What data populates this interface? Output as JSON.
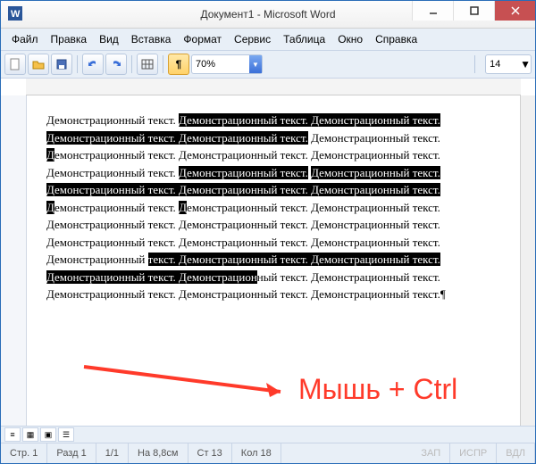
{
  "window": {
    "title": "Документ1 - Microsoft Word"
  },
  "menu": {
    "file": "Файл",
    "edit": "Правка",
    "view": "Вид",
    "insert": "Вставка",
    "format": "Формат",
    "tools": "Сервис",
    "table": "Таблица",
    "window_m": "Окно",
    "help": "Справка"
  },
  "toolbar": {
    "zoom": "70%",
    "font_size": "14"
  },
  "doc": {
    "seg1": "Демонстрационный текст. ",
    "seg_sel1": "Демонстрационный текст. Демонстрационный текст. Демонстрационный текст. Демонстрационный текст.",
    "seg2": " Демонстрационный текст. ",
    "seg_sel2": "Д",
    "seg3": "емонстрационный текст. Демонстрационный текст. Демонстрационный текст. Демонстрационный текст. ",
    "seg_sel3": "Демонстрационный текст.",
    "seg4": " ",
    "seg_sel4": "Демонстрационный текст. Демонстрационный текст. Демонстрационный текст. Демонстрационный текст. Д",
    "seg5": "емонстрационный текст. ",
    "seg_sel5": "Д",
    "seg6": "емонстрационный текст. Демонстрационный текст. Демонстрационный текст. Демонстрационный текст. Демонстрационный текст. Демонстрационный текст. Демонстрационный текст. Демонстрационный текст. Демонстрационный ",
    "seg_sel6": "текст. Демонстрационный текст. Демонстрационный текст. Демонстрационный текст. Демонстрацион",
    "seg7": "ный текст. Демонстрационный текст. Демонстрационный текст. Демонстрационный текст. Демонстрационный текст.¶"
  },
  "annot": {
    "text": "Мышь + Ctrl"
  },
  "status": {
    "page": "Стр. 1",
    "section": "Разд 1",
    "pages": "1/1",
    "at": "На 8,8см",
    "line": "Ст 13",
    "col": "Кол 18",
    "rec": "ЗАП",
    "trk": "ИСПР",
    "ext": "ВДЛ"
  }
}
